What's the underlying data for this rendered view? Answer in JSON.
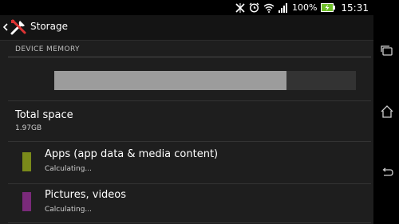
{
  "status_bar": {
    "battery_percent": "100%",
    "time": "15:31",
    "icons": [
      "nfc-icon",
      "alarm-icon",
      "wifi-icon",
      "signal-icon",
      "battery-charging-icon"
    ]
  },
  "action_bar": {
    "title": "Storage",
    "icons": [
      "back-chevron-icon",
      "tools-icon"
    ]
  },
  "section": {
    "header": "DEVICE MEMORY"
  },
  "usage_bar": {
    "used_fraction": 0.77,
    "fill_color": "#9c9c9c",
    "track_color": "#333333"
  },
  "total": {
    "label": "Total space",
    "value": "1.97GB"
  },
  "items": [
    {
      "label": "Apps (app data & media content)",
      "status": "Calculating...",
      "color": "#7a8a1a"
    },
    {
      "label": "Pictures, videos",
      "status": "Calculating...",
      "color": "#7a2a7a"
    }
  ],
  "nav_bar": {
    "icons": [
      "recent-apps-icon",
      "home-icon",
      "back-icon"
    ]
  }
}
